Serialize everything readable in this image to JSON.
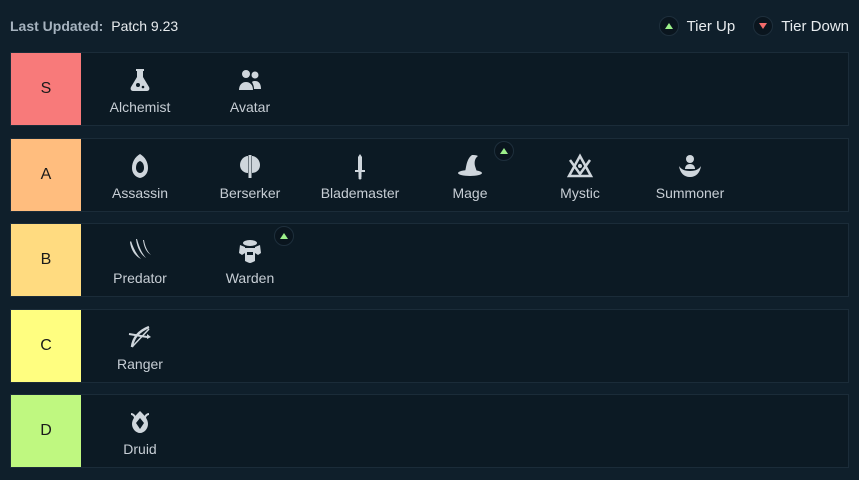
{
  "header": {
    "updated_label": "Last Updated:",
    "patch": "Patch 9.23"
  },
  "legend": {
    "up_label": "Tier Up",
    "down_label": "Tier Down"
  },
  "colors": {
    "S": "#f87a7a",
    "A": "#ffbd7e",
    "B": "#ffdb80",
    "C": "#fffe80",
    "D": "#bff880",
    "up": "#9cf08a",
    "down": "#f36b6b"
  },
  "tiers": [
    {
      "label": "S",
      "traits": [
        {
          "name": "Alchemist",
          "icon": "flask-icon",
          "tier_up": false
        },
        {
          "name": "Avatar",
          "icon": "avatar-icon",
          "tier_up": false
        }
      ]
    },
    {
      "label": "A",
      "traits": [
        {
          "name": "Assassin",
          "icon": "hood-icon",
          "tier_up": false
        },
        {
          "name": "Berserker",
          "icon": "axe-icon",
          "tier_up": false
        },
        {
          "name": "Blademaster",
          "icon": "sword-icon",
          "tier_up": false
        },
        {
          "name": "Mage",
          "icon": "wizard-hat-icon",
          "tier_up": true
        },
        {
          "name": "Mystic",
          "icon": "mystic-icon",
          "tier_up": false
        },
        {
          "name": "Summoner",
          "icon": "summoner-icon",
          "tier_up": false
        }
      ]
    },
    {
      "label": "B",
      "traits": [
        {
          "name": "Predator",
          "icon": "claw-icon",
          "tier_up": false
        },
        {
          "name": "Warden",
          "icon": "armor-icon",
          "tier_up": true
        }
      ]
    },
    {
      "label": "C",
      "traits": [
        {
          "name": "Ranger",
          "icon": "bow-icon",
          "tier_up": false
        }
      ]
    },
    {
      "label": "D",
      "traits": [
        {
          "name": "Druid",
          "icon": "leaf-icon",
          "tier_up": false
        }
      ]
    }
  ]
}
